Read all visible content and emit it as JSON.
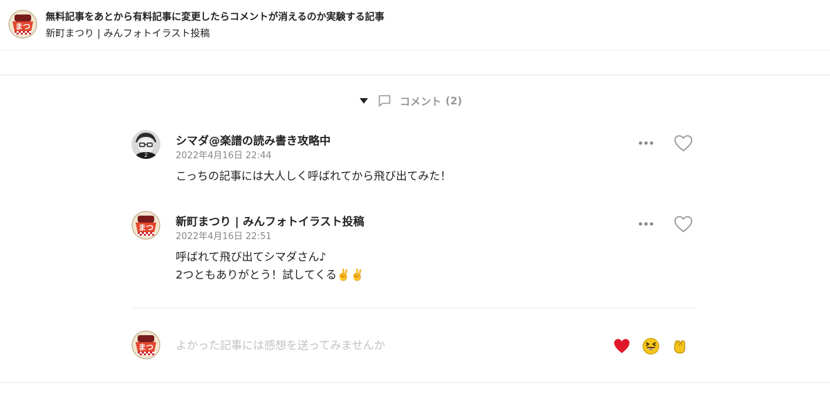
{
  "header": {
    "title": "無料記事をあとから有料記事に変更したらコメントが消えるのか実験する記事",
    "author": "新町まつり | みんフォトイラスト投稿"
  },
  "comments_section": {
    "label": "コメント",
    "count": "(2)",
    "icons": {
      "toggle": "caret-down-icon",
      "comment": "comment-bubble-icon"
    }
  },
  "comments": [
    {
      "author": "シマダ@楽譜の読み書き攻略中",
      "date": "2022年4月16日 22:44",
      "lines": [
        "こっちの記事には大人しく呼ばれてから飛び出てみた！"
      ]
    },
    {
      "author": "新町まつり | みんフォトイラスト投稿",
      "date": "2022年4月16日 22:51",
      "lines": [
        "呼ばれて飛び出てシマダさん♪",
        "2つともありがとう！試してくる✌️✌️"
      ]
    }
  ],
  "compose": {
    "placeholder": "よかった記事には感想を送ってみませんか",
    "reactions": [
      "heart-icon",
      "laughing-face-icon",
      "clapping-hands-icon"
    ]
  },
  "colors": {
    "heart": "#e0182d",
    "emoji_yellow": "#f5c51f",
    "muted": "#999999"
  }
}
